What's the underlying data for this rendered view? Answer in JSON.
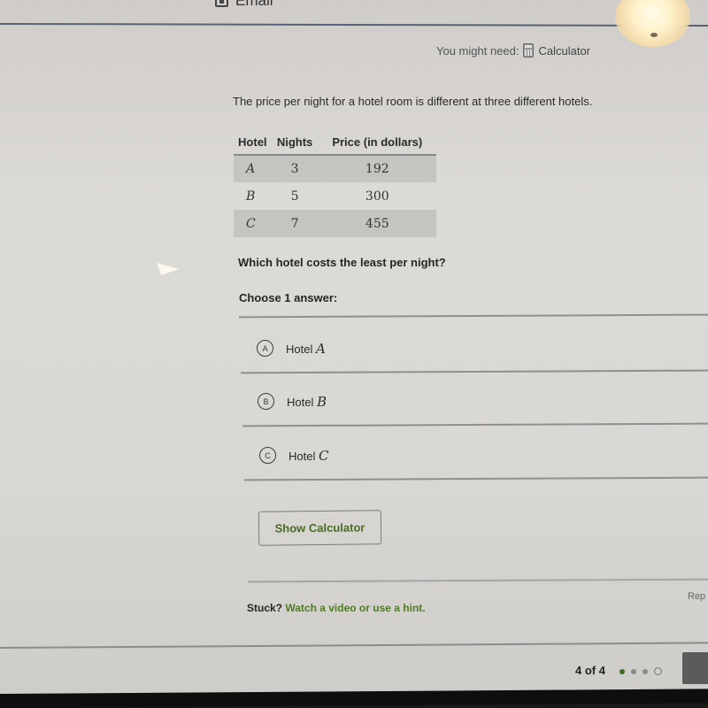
{
  "header": {
    "email_label": "Email",
    "might_need_label": "You might need:",
    "calculator_label": "Calculator"
  },
  "problem": {
    "intro": "The price per night for a hotel room is different at three different hotels.",
    "table": {
      "headers": [
        "Hotel",
        "Nights",
        "Price (in dollars)"
      ],
      "rows": [
        {
          "hotel": "A",
          "nights": "3",
          "price": "192"
        },
        {
          "hotel": "B",
          "nights": "5",
          "price": "300"
        },
        {
          "hotel": "C",
          "nights": "7",
          "price": "455"
        }
      ]
    },
    "question": "Which hotel costs the least per night?",
    "choose_label": "Choose 1 answer:",
    "choices": [
      {
        "letter": "A",
        "prefix": "Hotel",
        "var": "A"
      },
      {
        "letter": "B",
        "prefix": "Hotel",
        "var": "B"
      },
      {
        "letter": "C",
        "prefix": "Hotel",
        "var": "C"
      }
    ]
  },
  "actions": {
    "show_calculator_label": "Show Calculator"
  },
  "help": {
    "stuck_label": "Stuck?",
    "hint_link_label": "Watch a video or use a hint.",
    "report_label": "Rep"
  },
  "footer": {
    "progress_label": "4 of 4",
    "progress_current": 1,
    "progress_total": 4,
    "accent_color": "#3e6b22"
  }
}
